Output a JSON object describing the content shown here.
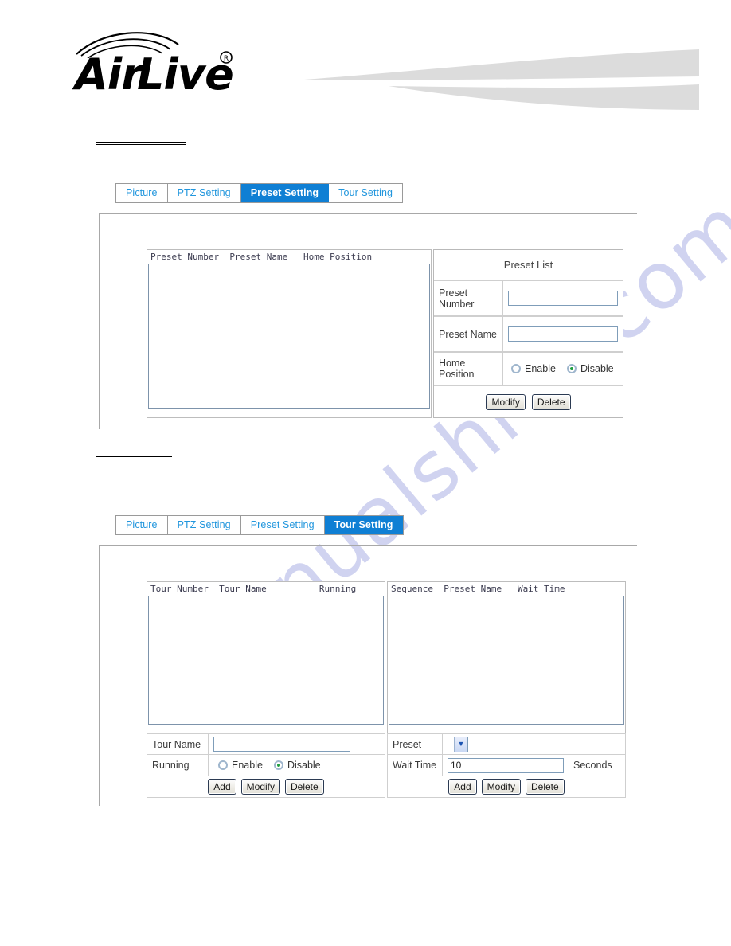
{
  "brand": {
    "name": "AirLive",
    "registered_mark": "®"
  },
  "watermark": {
    "text": "manualshive.com"
  },
  "sections": [
    {
      "id": "preset-setting",
      "tabs": [
        {
          "label": "Picture",
          "active": false
        },
        {
          "label": "PTZ Setting",
          "active": false
        },
        {
          "label": "Preset Setting",
          "active": true
        },
        {
          "label": "Tour Setting",
          "active": false
        }
      ],
      "preset_list_panel": {
        "list_header": "Preset Number  Preset Name   Home Position",
        "list_items": [],
        "title": "Preset List",
        "fields": [
          {
            "label": "Preset Number",
            "value": "",
            "placeholder": ""
          },
          {
            "label": "Preset Name",
            "value": "",
            "placeholder": ""
          }
        ],
        "home_position": {
          "label": "Home Position",
          "options": [
            {
              "label": "Enable",
              "selected": false
            },
            {
              "label": "Disable",
              "selected": true
            }
          ]
        },
        "buttons": [
          {
            "label": "Modify"
          },
          {
            "label": "Delete"
          }
        ]
      }
    },
    {
      "id": "tour-setting",
      "tabs": [
        {
          "label": "Picture",
          "active": false
        },
        {
          "label": "PTZ Setting",
          "active": false
        },
        {
          "label": "Preset Setting",
          "active": false
        },
        {
          "label": "Tour Setting",
          "active": true
        }
      ],
      "tour_panel": {
        "left": {
          "list_header": "Tour Number  Tour Name          Running",
          "list_items": [],
          "name_field": {
            "label": "Tour Name",
            "value": ""
          },
          "running": {
            "label": "Running",
            "options": [
              {
                "label": "Enable",
                "selected": false
              },
              {
                "label": "Disable",
                "selected": true
              }
            ]
          },
          "buttons": [
            {
              "label": "Add"
            },
            {
              "label": "Modify"
            },
            {
              "label": "Delete"
            }
          ]
        },
        "right": {
          "list_header": "Sequence  Preset Name   Wait Time",
          "list_items": [],
          "preset_field": {
            "label": "Preset",
            "selected_option": ""
          },
          "wait_time": {
            "label": "Wait Time",
            "value": "10",
            "unit": "Seconds"
          },
          "buttons": [
            {
              "label": "Add"
            },
            {
              "label": "Modify"
            },
            {
              "label": "Delete"
            }
          ]
        }
      }
    }
  ],
  "colors": {
    "tab_text": "#2196dd",
    "tab_active_bg": "#0f7fd4",
    "tab_active_text": "#ffffff",
    "swoosh": "#dcdcdc",
    "watermark": "#c8ccee",
    "radio_dot": "#1e9e3e"
  }
}
